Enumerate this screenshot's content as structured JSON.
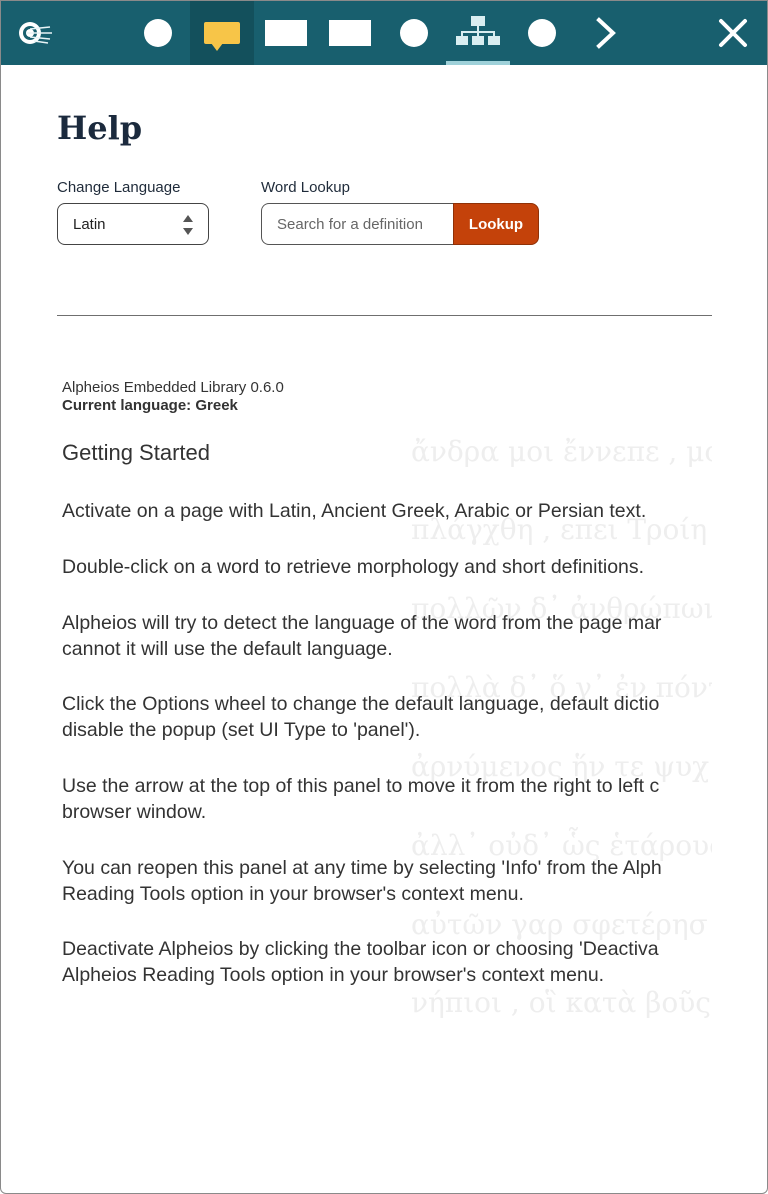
{
  "toolbar": {
    "icons": [
      "alpheios-logo-icon",
      "circle-icon",
      "speech-bubble-icon",
      "rectangle-icon",
      "rectangle-icon",
      "circle-icon",
      "hierarchy-icon",
      "circle-icon",
      "chevron-right-icon",
      "close-icon"
    ],
    "active_tab": "speech-bubble",
    "colors": {
      "bar": "#185f6e",
      "active": "#13505c",
      "bubble": "#f7c548",
      "underline": "#9fd1d9"
    }
  },
  "help": {
    "title": "Help",
    "change_language_label": "Change Language",
    "language_value": "Latin",
    "word_lookup_label": "Word Lookup",
    "search_placeholder": "Search for a definition",
    "lookup_button": "Lookup",
    "lookup_color": "#c4420a"
  },
  "info": {
    "version": "Alpheios Embedded Library 0.6.0",
    "current_language": "Current language: Greek",
    "getting_started": "Getting Started",
    "paragraphs": [
      {
        "lines": [
          "Activate on a page with Latin, Ancient Greek, Arabic or Persian text."
        ]
      },
      {
        "lines": [
          "Double-click on a word to retrieve morphology and short definitions."
        ]
      },
      {
        "lines": [
          "Alpheios will try to detect the language of the word from the page mar",
          "cannot it will use the default language."
        ]
      },
      {
        "lines": [
          "Click the Options wheel to change the default language, default dictio",
          "disable the popup (set UI Type to 'panel')."
        ]
      },
      {
        "lines": [
          "Use the arrow at the top of this panel to move it from the right to left c",
          "browser window."
        ]
      },
      {
        "lines": [
          "You can reopen this panel at any time by selecting 'Info' from the Alph",
          "Reading Tools option in your browser's context menu."
        ]
      },
      {
        "lines": [
          "Deactivate Alpheios by clicking the toolbar icon or choosing 'Deactiva",
          "Alpheios Reading Tools option in your browser's context menu."
        ]
      }
    ]
  },
  "background_text": {
    "lines": [
      "ἄνδρα μοι ἔννεπε , μο",
      "πλάγχθη , επει Τροίη",
      "πολλῶν δ᾽ ἀνθρώπων",
      "πολλὰ δ᾽ ὅ γ᾽ ἐν πόντ",
      "ἀρνύμενος ἥν τε ψυχ",
      "ἀλλ᾽ οὐδ᾽ ὧς ἑτάρους",
      "αὐτῶν γαρ σφετέρησ",
      "νήπιοι , οἳ κατὰ βοῦς"
    ]
  }
}
